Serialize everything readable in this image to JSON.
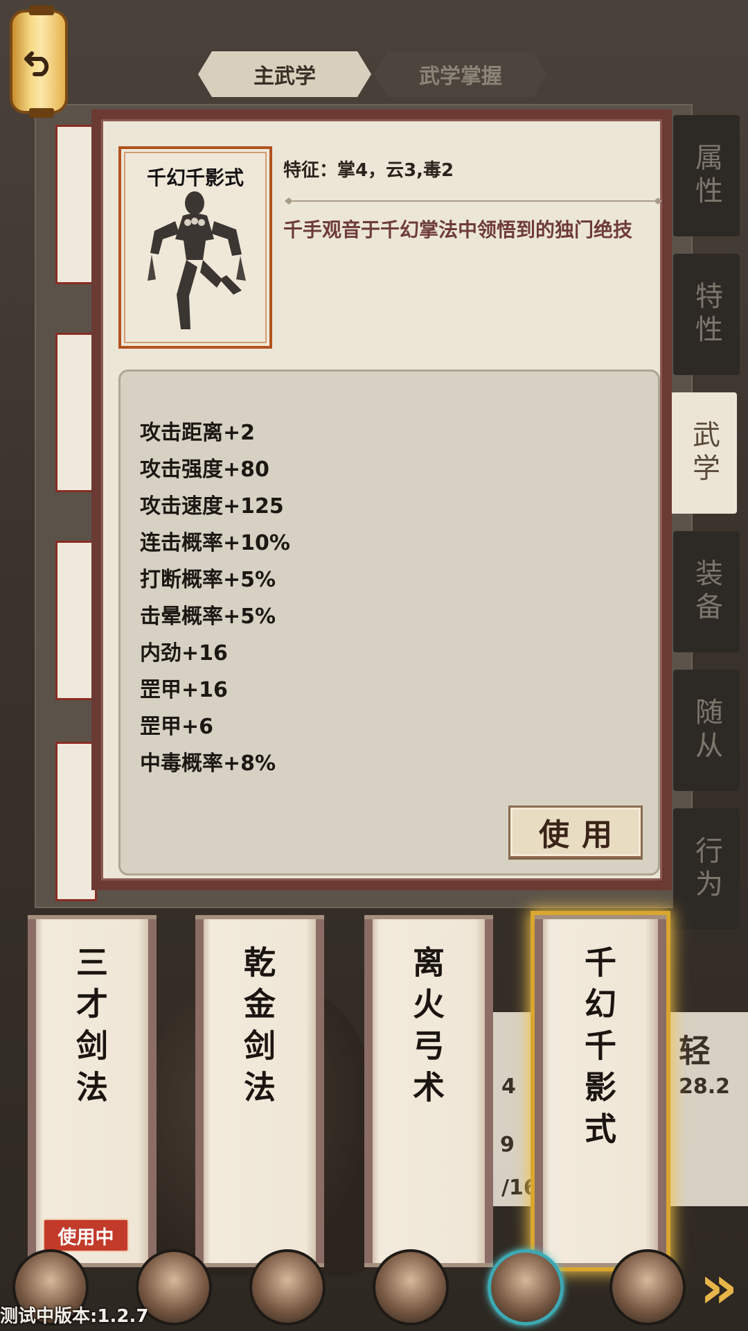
{
  "tabs": [
    {
      "label": "主武学",
      "active": true
    },
    {
      "label": "武学掌握",
      "active": false
    }
  ],
  "side_tabs": [
    {
      "label": "属性",
      "active": false
    },
    {
      "label": "特性",
      "active": false
    },
    {
      "label": "武学",
      "active": true
    },
    {
      "label": "装备",
      "active": false
    },
    {
      "label": "随从",
      "active": false
    },
    {
      "label": "行为",
      "active": false
    }
  ],
  "popup": {
    "skill_name": "千幻千影式",
    "trait": "特征：掌4，云3,毒2",
    "description": "千手观音于千幻掌法中领悟到的独门绝技",
    "stats": [
      "攻击距离+2",
      "攻击强度+80",
      "攻击速度+125",
      "连击概率+10%",
      "打断概率+5%",
      "击晕概率+5%",
      "内劲+16",
      "罡甲+16",
      "罡甲+6",
      "中毒概率+8%"
    ],
    "use_button": "使用"
  },
  "skills": [
    {
      "name": "三才剑法",
      "in_use": true,
      "selected": false
    },
    {
      "name": "乾金剑法",
      "in_use": false,
      "selected": false
    },
    {
      "name": "离火弓术",
      "in_use": false,
      "selected": false
    },
    {
      "name": "千幻千影式",
      "in_use": false,
      "selected": true
    }
  ],
  "in_use_label": "使用中",
  "background_stats": {
    "label_light": "轻",
    "value_light": "28.2",
    "partial_1": "4",
    "partial_2": "9",
    "partial_3": "/16"
  },
  "version_text": "测试中版本:1.2.7",
  "colors": {
    "popup_frame": "#6b3a33",
    "paper": "#ece6d7",
    "description_text": "#6e3b3a",
    "selected_glow": "#f3c548",
    "in_use_badge": "#c23a2a"
  }
}
